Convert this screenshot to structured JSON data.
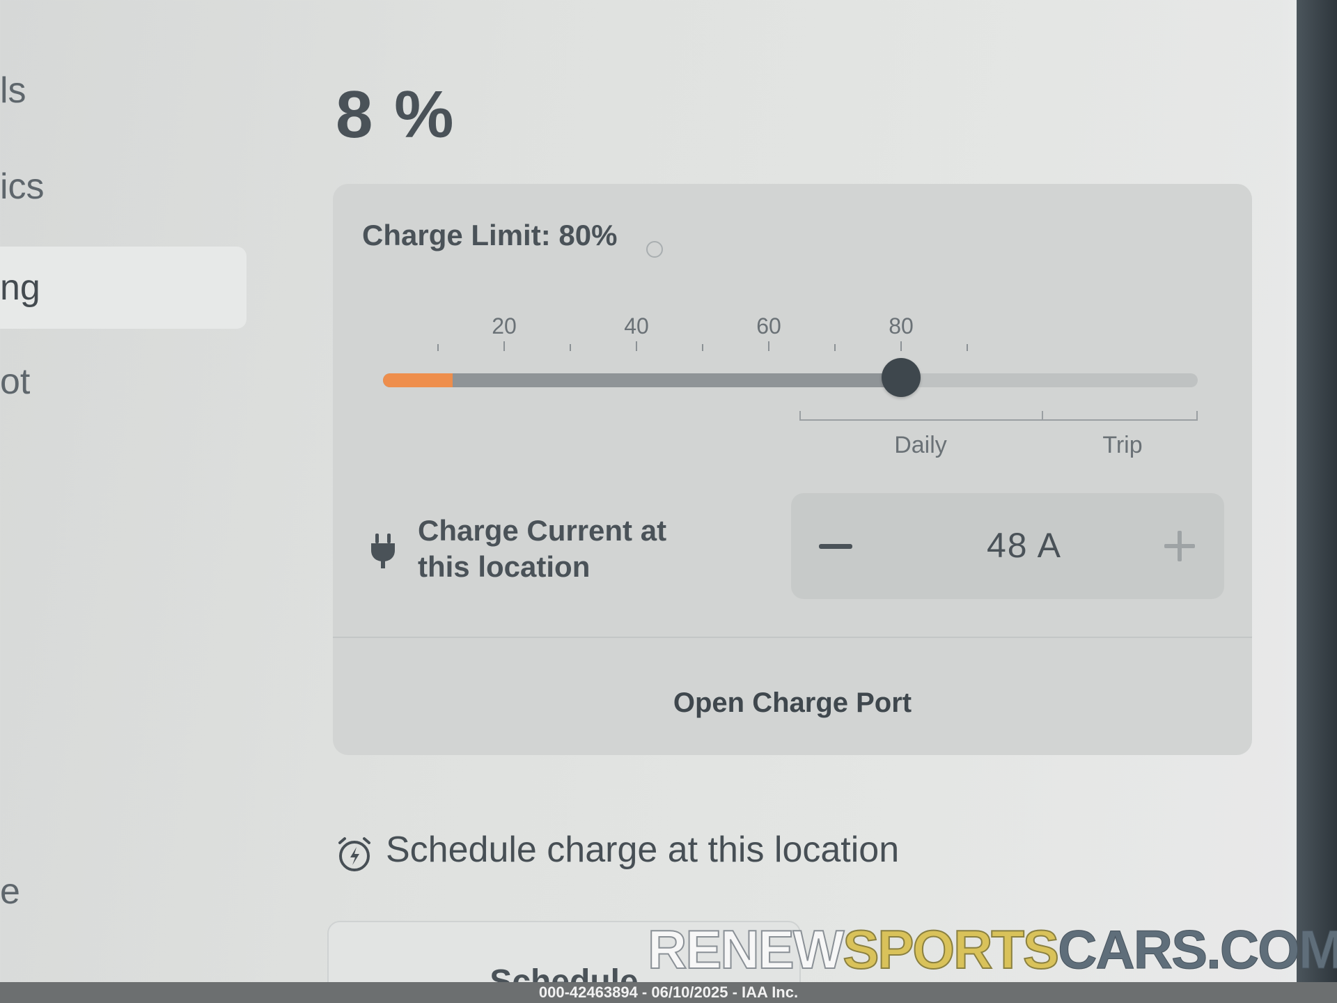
{
  "sidebar": {
    "items": [
      {
        "label": "ls"
      },
      {
        "label": "ics"
      },
      {
        "label": "ng",
        "active": true
      },
      {
        "label": "ot"
      },
      {
        "label": "e"
      }
    ]
  },
  "battery": {
    "percent_text": "8 %",
    "level_percent": 8
  },
  "charge_limit": {
    "label": "Charge Limit: 80%",
    "value_percent": 80,
    "tick_labels": [
      "20",
      "40",
      "60",
      "80"
    ],
    "daily_label": "Daily",
    "trip_label": "Trip"
  },
  "charge_current": {
    "label": "Charge Current at this location",
    "value_text": "48 A",
    "minus_symbol": "−",
    "plus_symbol": "+"
  },
  "actions": {
    "open_charge_port": "Open Charge Port"
  },
  "schedule": {
    "title": "Schedule charge at this location",
    "button_label": "Schedule"
  },
  "watermark": {
    "part1": "RENEW",
    "part2": "SPORTS",
    "part3": "CARS.COM"
  },
  "footer": {
    "caption": "000-42463894 - 06/10/2025 - IAA Inc."
  },
  "colors": {
    "accent_orange": "#ee8e4c",
    "thumb": "#3e474d",
    "watermark_yellow": "#d9c25a"
  },
  "icons": {
    "plug": "plug-icon",
    "schedule": "alarm-clock-lightning-icon",
    "info": "info-icon"
  }
}
